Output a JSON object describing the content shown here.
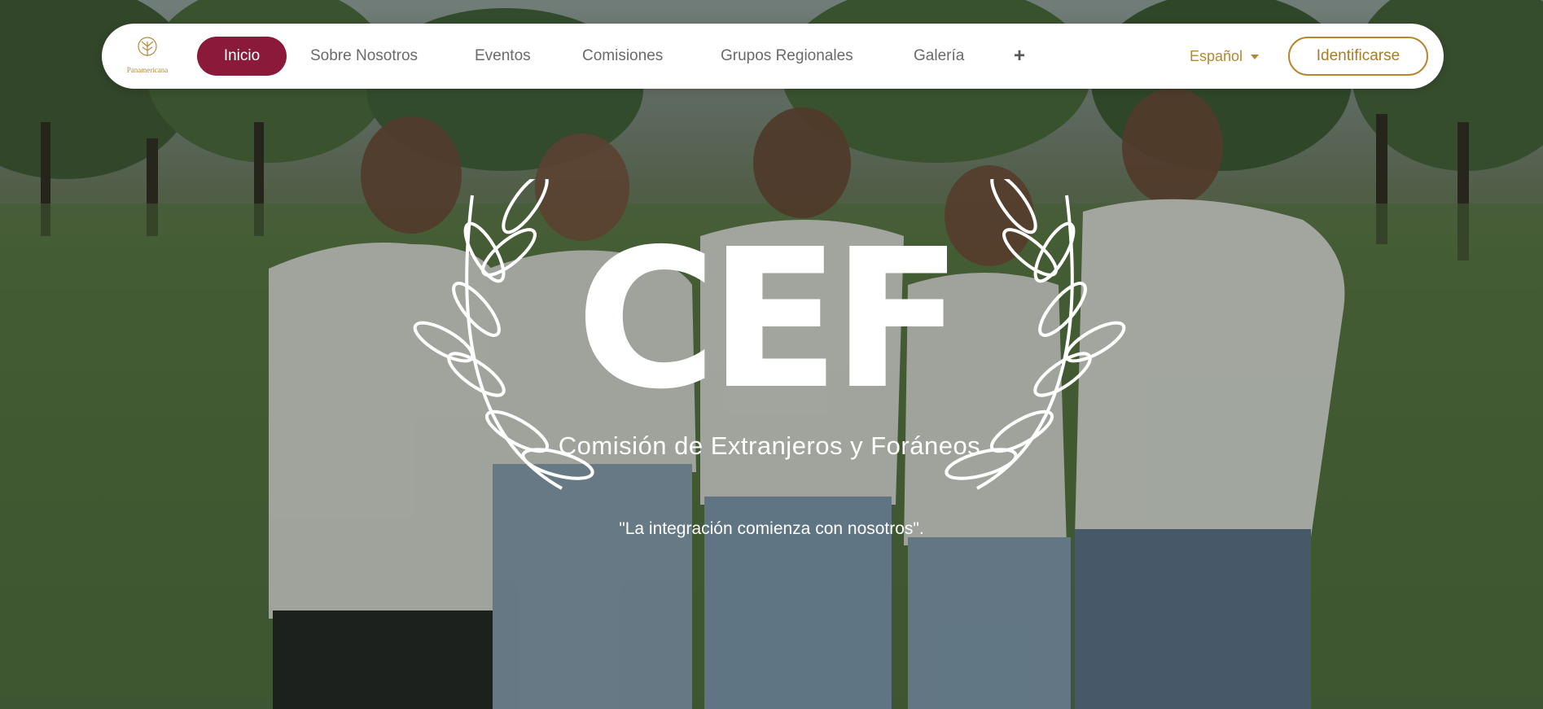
{
  "logo": {
    "icon": "tree-crest-icon",
    "text": "Panamericana"
  },
  "nav": {
    "items": [
      {
        "label": "Inicio",
        "active": true
      },
      {
        "label": "Sobre Nosotros",
        "active": false
      },
      {
        "label": "Eventos",
        "active": false
      },
      {
        "label": "Comisiones",
        "active": false
      },
      {
        "label": "Grupos Regionales",
        "active": false
      },
      {
        "label": "Galería",
        "active": false
      }
    ],
    "more_icon": "plus-icon",
    "more_label": "+",
    "language": "Español",
    "login_label": "Identificarse"
  },
  "hero": {
    "emblem_text": "CEF",
    "subtitle": "Comisión de Extranjeros y Foráneos",
    "tagline": "\"La integración comienza con nosotros\"."
  },
  "colors": {
    "primary": "#8b1a3a",
    "accent_gold": "#b7872f",
    "nav_bg": "#ffffff",
    "hero_text": "#ffffff"
  }
}
